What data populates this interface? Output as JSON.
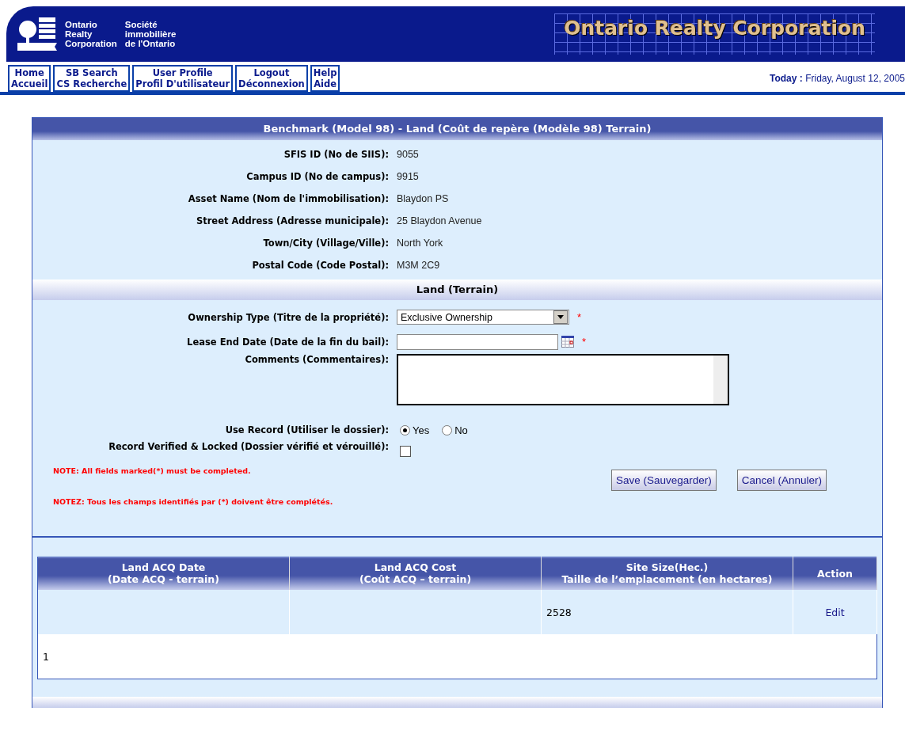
{
  "header": {
    "org_en": [
      "Ontario",
      "Realty",
      "Corporation"
    ],
    "org_fr": [
      "Société",
      "immobilière",
      "de l'Ontario"
    ],
    "banner_title": "Ontario Realty Corporation"
  },
  "nav": [
    {
      "line1": "Home",
      "line2": "Accueil"
    },
    {
      "line1": "SB Search",
      "line2": "CS Recherche"
    },
    {
      "line1": "User Profile",
      "line2": "Profil D'utilisateur"
    },
    {
      "line1": "Logout",
      "line2": "Déconnexion"
    },
    {
      "line1": "Help",
      "line2": "Aide"
    }
  ],
  "today": {
    "label": "Today :",
    "value": "Friday, August 12, 2005"
  },
  "panel_title": "Benchmark (Model 98) - Land (Coût de repère (Modèle 98) Terrain)",
  "details": [
    {
      "label": "SFIS ID (No de SIIS):",
      "value": "9055"
    },
    {
      "label": "Campus ID (No de campus):",
      "value": "9915"
    },
    {
      "label": "Asset Name (Nom de l'immobilisation):",
      "value": "Blaydon PS"
    },
    {
      "label": "Street Address (Adresse municipale):",
      "value": "25 Blaydon Avenue"
    },
    {
      "label": "Town/City (Village/Ville):",
      "value": "North York"
    },
    {
      "label": "Postal Code (Code Postal):",
      "value": "M3M 2C9"
    }
  ],
  "land_title": "Land (Terrain)",
  "required_mark": "*",
  "form": [
    {
      "kind": "select",
      "label": "Ownership Type (Titre de la propriété):",
      "value": "Exclusive Ownership",
      "required": true
    },
    {
      "kind": "date",
      "label": "Lease End Date (Date de la fin du bail):",
      "required": true
    },
    {
      "kind": "textarea",
      "label": "Comments (Commentaires):"
    },
    {
      "kind": "radio",
      "label": "Use Record (Utiliser le dossier):",
      "options": [
        {
          "label": "Yes",
          "selected": true
        },
        {
          "label": "No",
          "selected": false
        }
      ]
    },
    {
      "kind": "checkbox",
      "label": "Record Verified & Locked (Dossier vérifié et vérouillé):",
      "checked": false
    }
  ],
  "notes": [
    "NOTE: All fields marked(*) must be completed.",
    "NOTEZ: Tous les champs identifiés par (*) doivent être complétés."
  ],
  "buttons": [
    "Save (Sauvegarder)",
    "Cancel (Annuler)"
  ],
  "table": {
    "columns": [
      {
        "title": "Land ACQ Date",
        "subtitle": "(Date ACQ - terrain)"
      },
      {
        "title": "Land ACQ Cost",
        "subtitle": "(Coût ACQ – terrain)"
      },
      {
        "title": "Site Size(Hec.)",
        "subtitle": "Taille de l’emplacement (en hectares)"
      },
      {
        "title": "Action"
      }
    ],
    "rows": [
      {
        "cells": [
          "",
          "",
          "2528"
        ],
        "action": "Edit"
      }
    ],
    "footer": "1"
  }
}
